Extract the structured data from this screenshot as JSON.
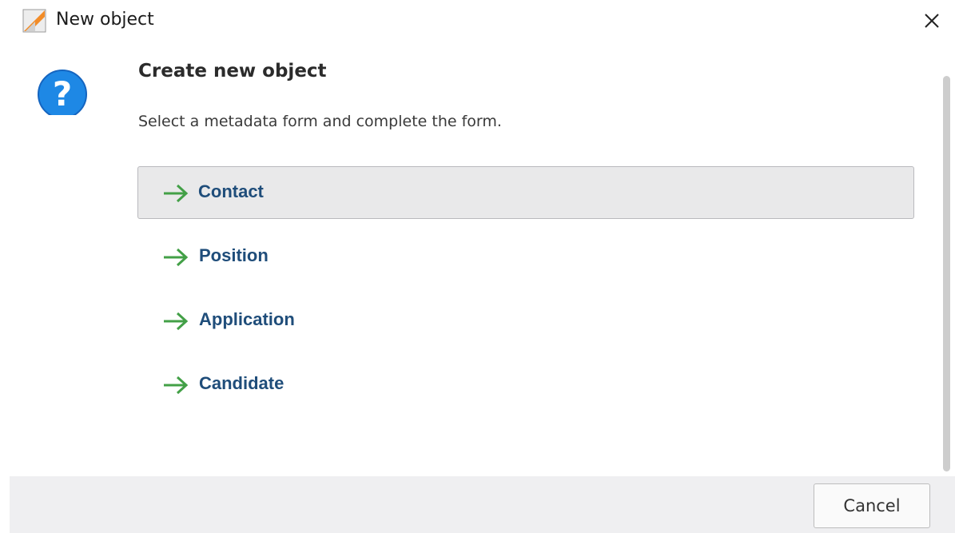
{
  "window": {
    "title": "New object",
    "app_icon": "app-logo-icon",
    "close_icon": "close-icon"
  },
  "dialog": {
    "icon": "question-icon",
    "heading": "Create new object",
    "subtitle": "Select a metadata form and complete the form.",
    "options": [
      {
        "label": "Contact",
        "icon": "arrow-right-icon",
        "selected": true
      },
      {
        "label": "Position",
        "icon": "arrow-right-icon",
        "selected": false
      },
      {
        "label": "Application",
        "icon": "arrow-right-icon",
        "selected": false
      },
      {
        "label": "Candidate",
        "icon": "arrow-right-icon",
        "selected": false
      }
    ]
  },
  "footer": {
    "cancel_label": "Cancel"
  },
  "colors": {
    "accent_blue": "#1e88e5",
    "option_text": "#1f4d7a",
    "arrow_green": "#43a047",
    "selected_bg": "#e9e9ea",
    "footer_bg": "#efeff1"
  }
}
